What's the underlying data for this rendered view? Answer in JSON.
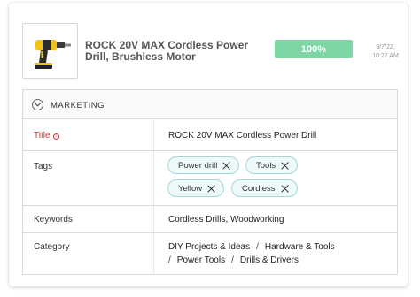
{
  "product": {
    "name": "ROCK 20V MAX Cordless Power Drill, Brushless Motor",
    "image_icon": "power-drill-image"
  },
  "progress": {
    "label": "100%",
    "value": 1.0,
    "color": "#7ed6a5"
  },
  "timestamp": {
    "date": "9/7/22,",
    "time": "10:27 AM"
  },
  "section": {
    "label": "MARKETING",
    "icon": "chevron-down-icon"
  },
  "fields": {
    "title": {
      "label": "Title",
      "value": "ROCK 20V MAX Cordless Power Drill"
    },
    "tags": {
      "label": "Tags",
      "items": [
        "Power drill",
        "Tools",
        "Yellow",
        "Cordless"
      ]
    },
    "keywords": {
      "label": "Keywords",
      "value": "Cordless Drills, Woodworking"
    },
    "category": {
      "label": "Category",
      "path": [
        "DIY Projects & Ideas",
        "Hardware & Tools",
        "Power Tools",
        "Drills & Drivers"
      ],
      "separator": "/"
    }
  },
  "colors": {
    "accent_teal": "#9fd8da",
    "required_red": "#c9343b"
  }
}
